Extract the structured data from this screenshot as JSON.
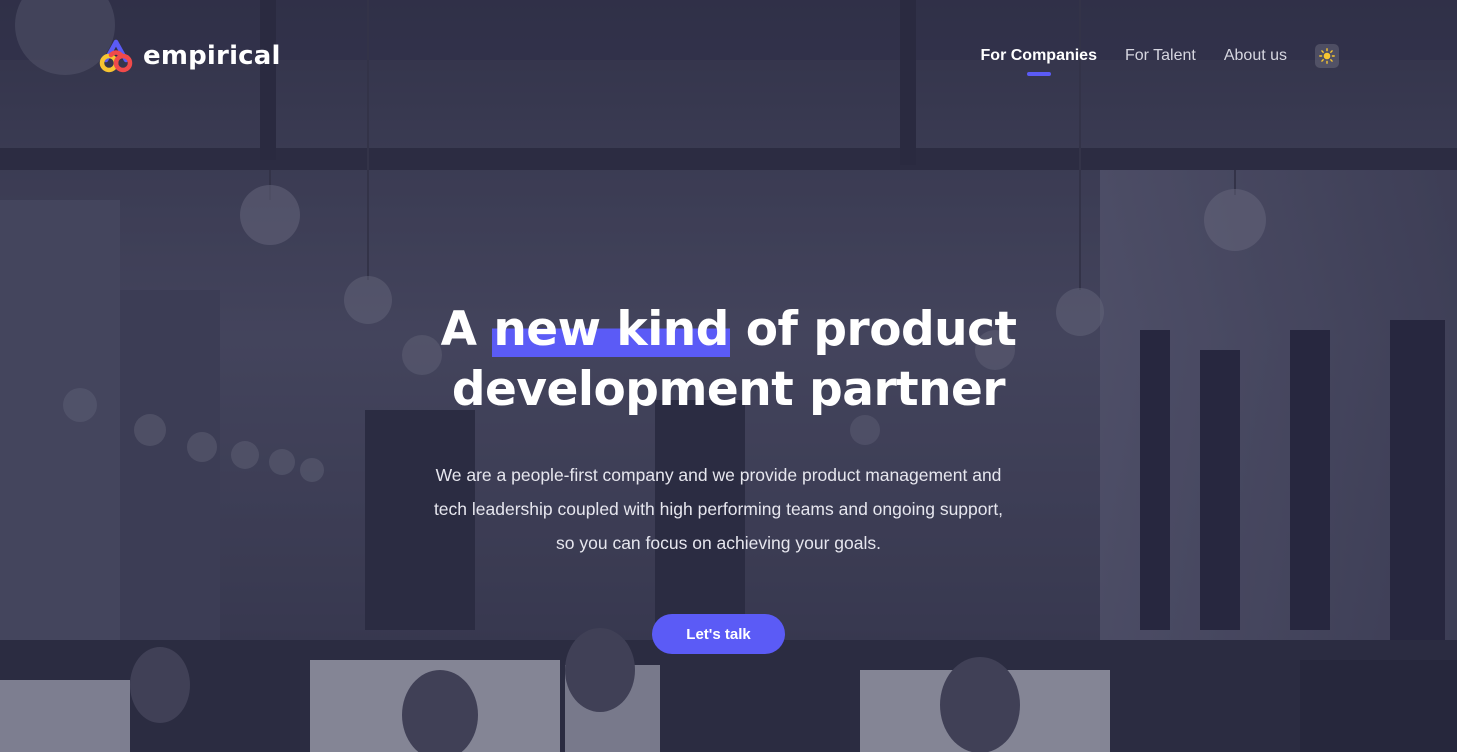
{
  "brand": {
    "name": "empirical",
    "logo_icon": "empirical-triangle-knot-logo",
    "logo_colors": [
      "#5b5bf6",
      "#f04a4a",
      "#f7c531"
    ]
  },
  "nav": {
    "items": [
      {
        "label": "For Companies",
        "active": true
      },
      {
        "label": "For Talent",
        "active": false
      },
      {
        "label": "About us",
        "active": false
      }
    ],
    "theme_toggle_icon": "sun-icon"
  },
  "hero": {
    "title_before": "A ",
    "title_highlight": "new kind",
    "title_after_line1": " of product",
    "title_line2": "development partner",
    "subtitle": "We are a people-first company and we provide product management and tech leadership coupled with high performing teams and ongoing support, so you can focus on achieving your goals.",
    "cta_label": "Let's talk"
  },
  "colors": {
    "accent": "#5b5bf6",
    "text": "#ffffff",
    "nav_inactive": "#d6d6e0"
  }
}
